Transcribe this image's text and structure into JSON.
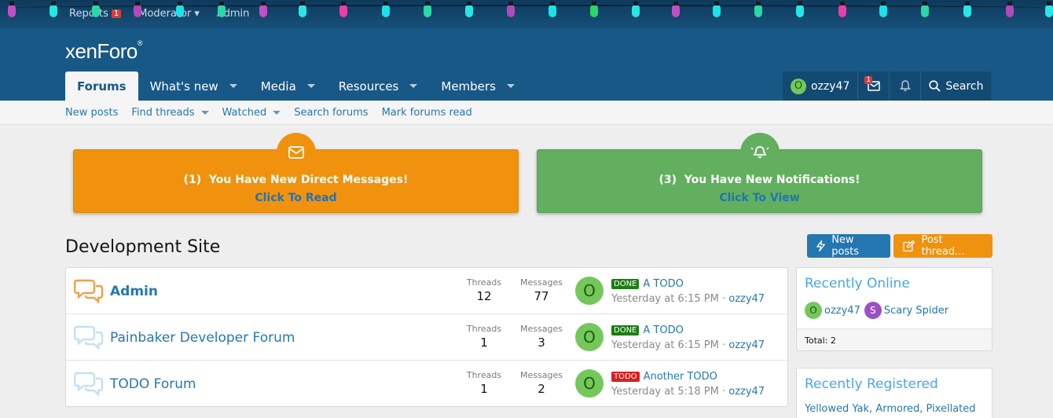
{
  "staff_bar": {
    "reports_label": "Reports",
    "reports_count": "1",
    "moderator_label": "Moderator",
    "admin_label": "Admin"
  },
  "brand": {
    "logo_text": "xenForo",
    "logo_mark": "®"
  },
  "nav": {
    "tabs": [
      {
        "label": "Forums"
      },
      {
        "label": "What's new"
      },
      {
        "label": "Media"
      },
      {
        "label": "Resources"
      },
      {
        "label": "Members"
      }
    ]
  },
  "user_nav": {
    "avatar_letter": "O",
    "username": "ozzy47",
    "inbox_count": "1",
    "search_label": "Search"
  },
  "subnav": {
    "links": [
      {
        "label": "New posts"
      },
      {
        "label": "Find threads"
      },
      {
        "label": "Watched"
      },
      {
        "label": "Search forums"
      },
      {
        "label": "Mark forums read"
      }
    ]
  },
  "notices": {
    "messages": {
      "title": "(1)  You Have New Direct Messages!",
      "link": "Click To Read",
      "color": "#f0920e"
    },
    "notifications": {
      "title": "(3)  You Have New Notifications!",
      "link": "Click To View",
      "color": "#63af60"
    }
  },
  "page": {
    "title": "Development Site",
    "new_posts_label": "New posts",
    "post_thread_label": "Post thread..."
  },
  "forum_list": {
    "threads_label": "Threads",
    "messages_label": "Messages",
    "forums": [
      {
        "name": "Admin",
        "threads": "12",
        "messages": "77",
        "avatar": "O",
        "prefix": "DONE",
        "latest_title": "A TODO",
        "latest_time": "Yesterday at 6:15 PM",
        "latest_user": "ozzy47"
      },
      {
        "name": "Painbaker Developer Forum",
        "threads": "1",
        "messages": "3",
        "avatar": "O",
        "prefix": "DONE",
        "latest_title": "A TODO",
        "latest_time": "Yesterday at 6:15 PM",
        "latest_user": "ozzy47"
      },
      {
        "name": "TODO Forum",
        "threads": "1",
        "messages": "2",
        "avatar": "O",
        "prefix": "TODO",
        "latest_title": "Another TODO",
        "latest_time": "Yesterday at 5:18 PM",
        "latest_user": "ozzy47"
      }
    ]
  },
  "sidebar": {
    "online": {
      "title": "Recently Online",
      "users": [
        {
          "letter": "O",
          "name": "ozzy47",
          "color": "#74c85a"
        },
        {
          "letter": "S",
          "name": "Scary Spider",
          "color": "#9c4fc4"
        }
      ],
      "total": "Total: 2"
    },
    "registered": {
      "title": "Recently Registered",
      "names": "Yellowed Yak, Armored, Pixellated"
    }
  }
}
